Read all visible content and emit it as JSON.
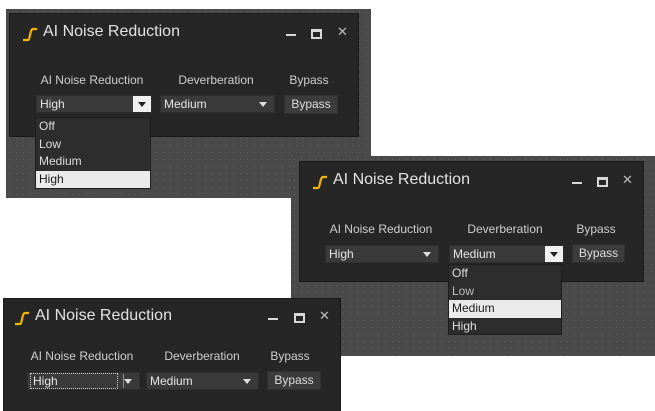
{
  "window_title": "AI Noise Reduction",
  "column_labels": {
    "noise_reduction": "AI Noise Reduction",
    "deverberation": "Deverberation",
    "bypass": "Bypass"
  },
  "panels": [
    {
      "noise_reduction_value": "High",
      "deverberation_value": "Medium",
      "bypass_label": "Bypass",
      "open_dropdown": "noise_reduction",
      "options": [
        "Off",
        "Low",
        "Medium",
        "High"
      ],
      "highlighted_option": "High"
    },
    {
      "noise_reduction_value": "High",
      "deverberation_value": "Medium",
      "bypass_label": "Bypass",
      "open_dropdown": "deverberation",
      "options": [
        "Off",
        "Low",
        "Medium",
        "High"
      ],
      "highlighted_option": "Medium"
    },
    {
      "noise_reduction_value": "High",
      "deverberation_value": "Medium",
      "bypass_label": "Bypass",
      "open_dropdown": null,
      "focused_dropdown": "noise_reduction"
    }
  ],
  "colors": {
    "panel_bg": "#262626",
    "canvas_bg": "#4a4a4a",
    "logo_accent": "#f0b400",
    "highlight": "#eaeaea"
  },
  "icons": {
    "logo": "curve-logo-icon",
    "minimize": "minimize-icon",
    "maximize": "maximize-icon",
    "close": "close-icon",
    "dropdown": "chevron-down-icon"
  }
}
